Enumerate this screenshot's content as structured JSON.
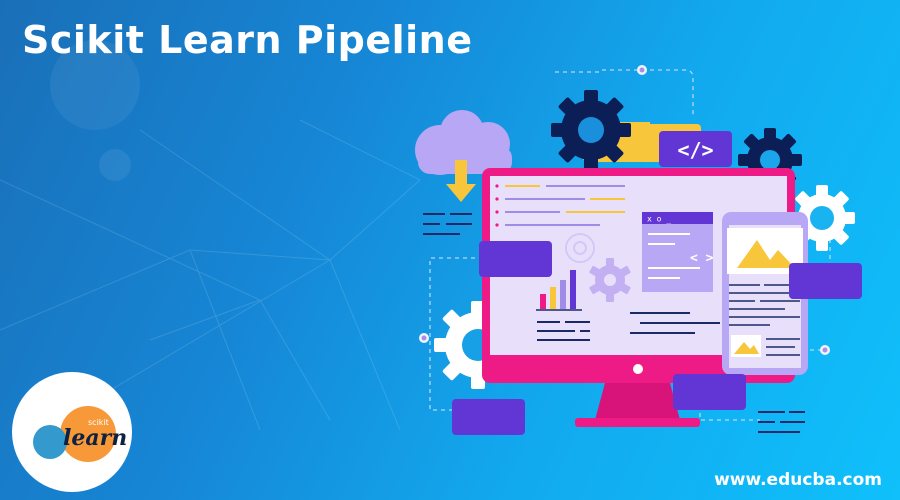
{
  "banner": {
    "title": "Scikit Learn Pipeline",
    "website": "www.educba.com",
    "logo": {
      "small_text": "scikit",
      "word": "learn"
    },
    "code_tag": "</>",
    "window_tag": "x o _",
    "window_code": "< >",
    "colors": {
      "monitor": "#ee1b87",
      "purple": "#6236d4",
      "gear_dark": "#0c1e56",
      "cloud": "#b7a7f5",
      "yellow": "#f8c63a",
      "screen": "#e8e0fb"
    }
  }
}
